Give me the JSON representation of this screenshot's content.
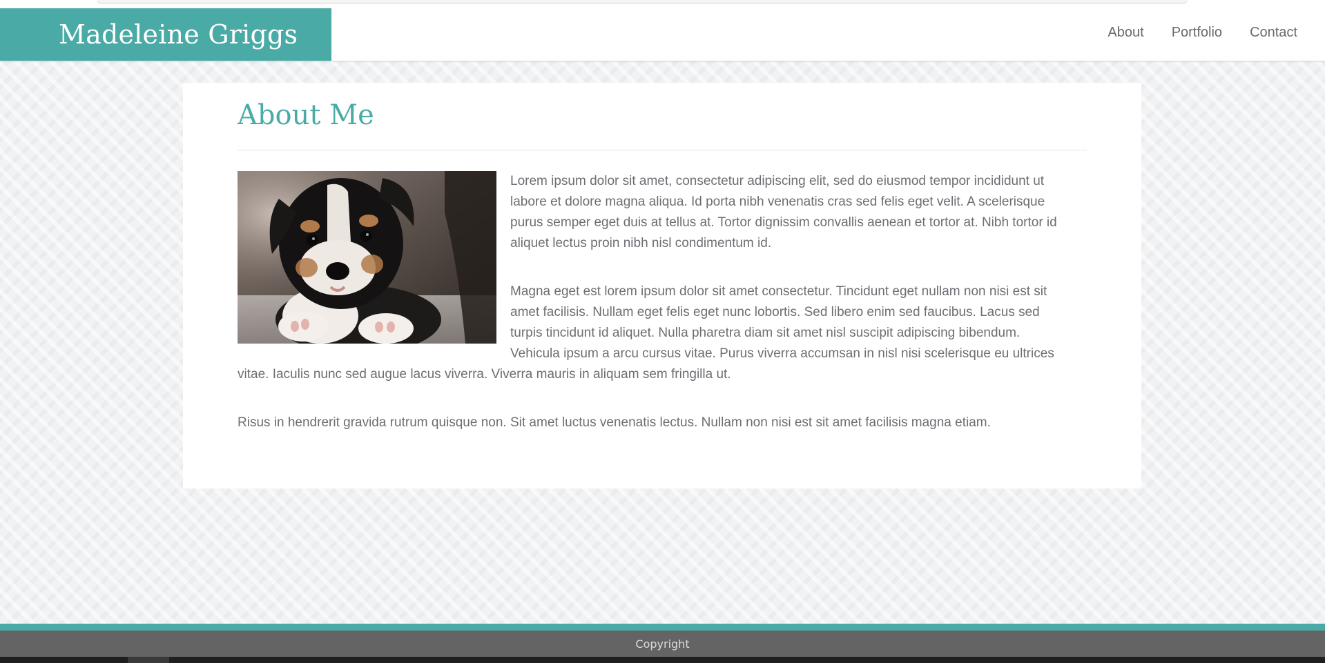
{
  "header": {
    "brand": "Madeleine Griggs",
    "nav": [
      "About",
      "Portfolio",
      "Contact"
    ]
  },
  "main": {
    "title": "About Me",
    "image_alt": "Puppy",
    "paragraphs": [
      "Lorem ipsum dolor sit amet, consectetur adipiscing elit, sed do eiusmod tempor incididunt ut labore et dolore magna aliqua. Id porta nibh venenatis cras sed felis eget velit. A scelerisque purus semper eget duis at tellus at. Tortor dignissim convallis aenean et tortor at. Nibh tortor id aliquet lectus proin nibh nisl condimentum id.",
      "Magna eget est lorem ipsum dolor sit amet consectetur. Tincidunt eget nullam non nisi est sit amet facilisis. Nullam eget felis eget nunc lobortis. Sed libero enim sed faucibus. Lacus sed turpis tincidunt id aliquet. Nulla pharetra diam sit amet nisl suscipit adipiscing bibendum. Vehicula ipsum a arcu cursus vitae. Purus viverra accumsan in nisl nisi scelerisque eu ultrices vitae. Iaculis nunc sed augue lacus viverra. Viverra mauris in aliquam sem fringilla ut.",
      "Risus in hendrerit gravida rutrum quisque non. Sit amet luctus venenatis lectus. Nullam non nisi est sit amet facilisis magna etiam."
    ]
  },
  "footer": {
    "text": "Copyright"
  },
  "colors": {
    "accent": "#4aaba6",
    "footer_bg": "#646464",
    "text": "#6b6e72"
  }
}
